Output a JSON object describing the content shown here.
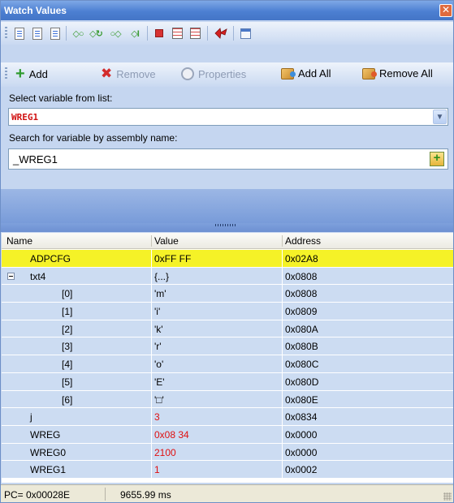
{
  "window": {
    "title": "Watch Values",
    "close_glyph": "✕"
  },
  "toolbar1": {
    "icons": [
      "doc-icon",
      "doc-icon",
      "doc-delete-icon",
      "step-into-icon",
      "step-over-icon",
      "step-out-icon",
      "run-to-cursor-icon",
      "breakpoint-icon",
      "list-icon",
      "windows-icon",
      "red-arrow-icon",
      "window-icon"
    ]
  },
  "toolbar2": {
    "add_label": "Add",
    "remove_label": "Remove",
    "properties_label": "Properties",
    "add_all_label": "Add All",
    "remove_all_label": "Remove All"
  },
  "form": {
    "select_label": "Select variable from list:",
    "select_value": "WREG1",
    "search_label": "Search for variable by assembly name:",
    "search_value": "_WREG1"
  },
  "grid": {
    "columns": [
      "Name",
      "Value",
      "Address"
    ],
    "rows": [
      {
        "name": "ADPCFG",
        "value": "0xFF FF",
        "address": "0x02A8",
        "highlight": true,
        "red": false,
        "indent": 1,
        "expandable": false
      },
      {
        "name": "txt4",
        "value": "{...}",
        "address": "0x0808",
        "highlight": false,
        "red": false,
        "indent": 1,
        "expandable": true
      },
      {
        "name": "[0]",
        "value": "'m'",
        "address": "0x0808",
        "highlight": false,
        "red": false,
        "indent": 2,
        "expandable": false
      },
      {
        "name": "[1]",
        "value": "'i'",
        "address": "0x0809",
        "highlight": false,
        "red": false,
        "indent": 2,
        "expandable": false
      },
      {
        "name": "[2]",
        "value": "'k'",
        "address": "0x080A",
        "highlight": false,
        "red": false,
        "indent": 2,
        "expandable": false
      },
      {
        "name": "[3]",
        "value": "'r'",
        "address": "0x080B",
        "highlight": false,
        "red": false,
        "indent": 2,
        "expandable": false
      },
      {
        "name": "[4]",
        "value": "'o'",
        "address": "0x080C",
        "highlight": false,
        "red": false,
        "indent": 2,
        "expandable": false
      },
      {
        "name": "[5]",
        "value": "'E'",
        "address": "0x080D",
        "highlight": false,
        "red": false,
        "indent": 2,
        "expandable": false
      },
      {
        "name": "[6]",
        "value": "'□'",
        "address": "0x080E",
        "highlight": false,
        "red": false,
        "indent": 2,
        "expandable": false
      },
      {
        "name": "j",
        "value": "3",
        "address": "0x0834",
        "highlight": false,
        "red": true,
        "indent": 1,
        "expandable": false
      },
      {
        "name": "WREG",
        "value": "0x08 34",
        "address": "0x0000",
        "highlight": false,
        "red": true,
        "indent": 1,
        "expandable": false
      },
      {
        "name": "WREG0",
        "value": "2100",
        "address": "0x0000",
        "highlight": false,
        "red": true,
        "indent": 1,
        "expandable": false
      },
      {
        "name": "WREG1",
        "value": "1",
        "address": "0x0002",
        "highlight": false,
        "red": true,
        "indent": 1,
        "expandable": false
      }
    ]
  },
  "status": {
    "pc": "PC= 0x00028E",
    "time": "9655.99 ms"
  }
}
